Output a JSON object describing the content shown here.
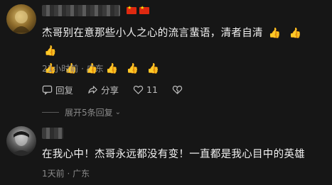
{
  "comments": [
    {
      "text": "杰哥别在意那些小人之心的流言蜚语，清者自清",
      "emojis": [
        "👍",
        "👍",
        "👍",
        "👍",
        "👍",
        "👍",
        "👍",
        "👍",
        "👍",
        "👍"
      ],
      "time": "21小时前 · 广东",
      "actions": {
        "reply": "回复",
        "share": "分享",
        "like_count": "11"
      },
      "expand_replies": "展开5条回复"
    },
    {
      "text": "在我心中！杰哥永远都没有变！一直都是我心目中的英雄",
      "time": "1天前 · 广东"
    }
  ],
  "icons": {
    "reply": "reply-icon",
    "share": "share-icon",
    "like": "heart-icon",
    "dislike": "dislike-icon",
    "flag": "china-flag-icon"
  }
}
